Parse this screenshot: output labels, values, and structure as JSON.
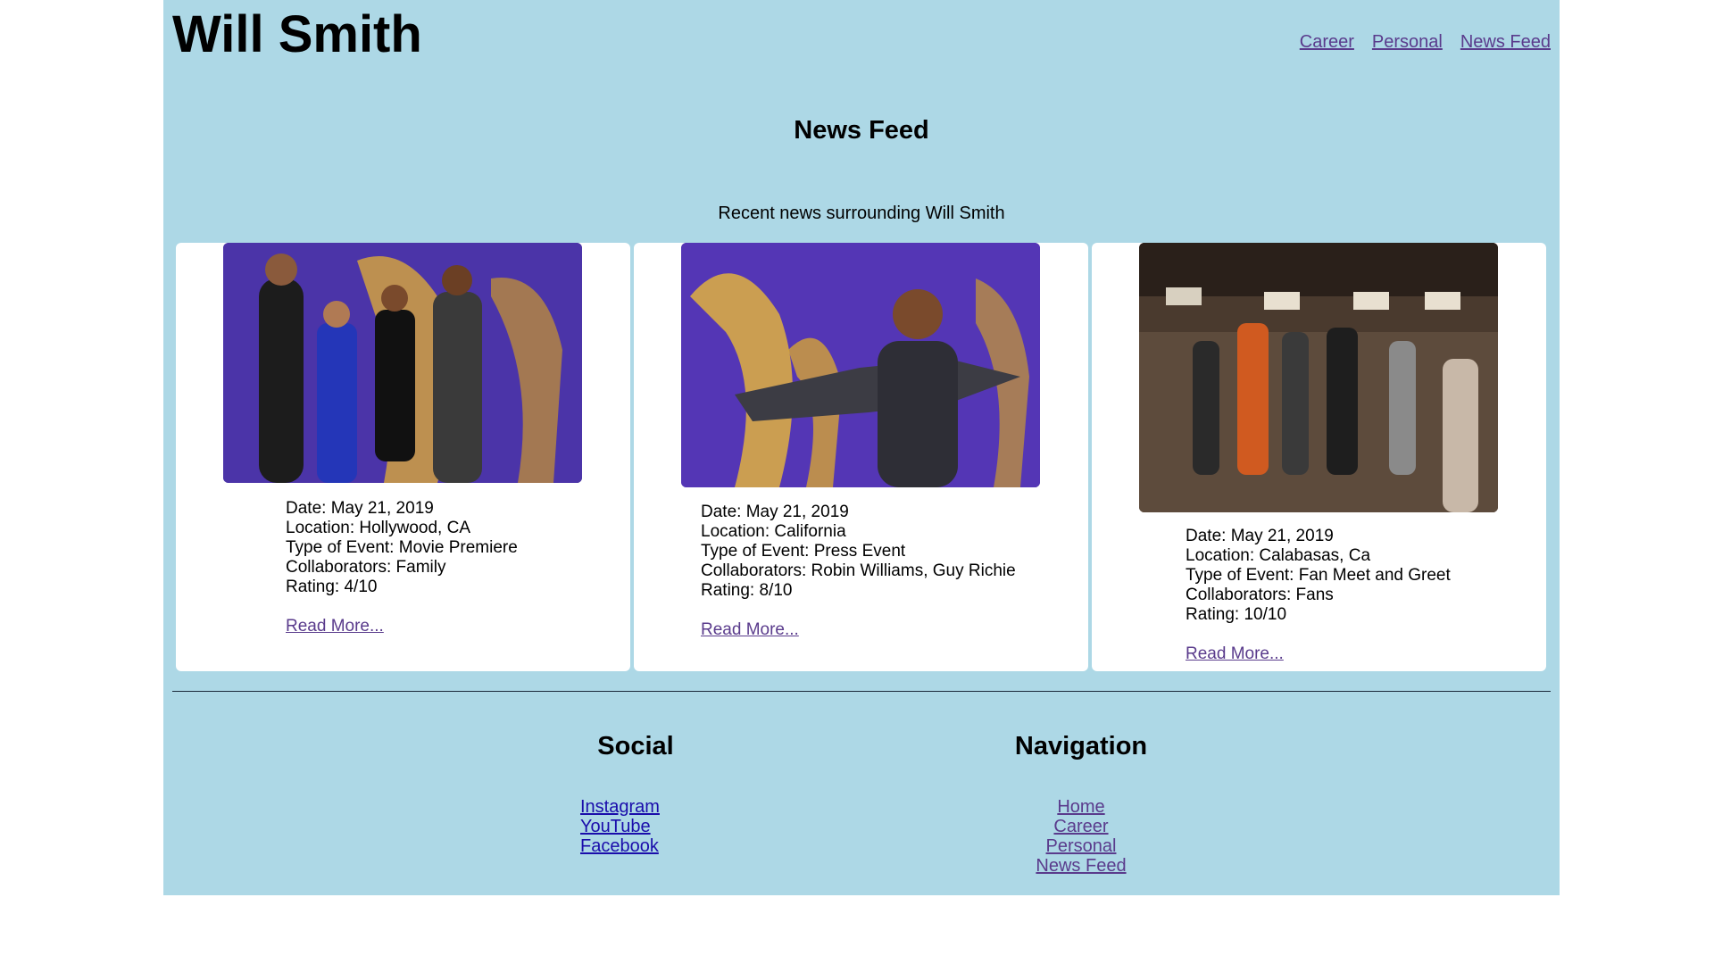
{
  "header": {
    "title": "Will Smith",
    "nav": [
      "Career",
      "Personal",
      "News Feed"
    ]
  },
  "main": {
    "heading": "News Feed",
    "subtitle": "Recent news surrounding Will Smith",
    "cards": [
      {
        "image": "Will Smith with family at Aladdin premiere",
        "date": "Date: May 21, 2019",
        "location": "Location: Hollywood, CA",
        "event": "Type of Event: Movie Premiere",
        "collaborators": "Collaborators: Family",
        "rating": "Rating: 4/10",
        "link": "Read More..."
      },
      {
        "image": "Will Smith posing at Aladdin press event",
        "date": "Date: May 21, 2019",
        "location": "Location: California",
        "event": "Type of Event: Press Event",
        "collaborators": "Collaborators: Robin Williams, Guy Richie",
        "rating": "Rating: 8/10",
        "link": "Read More..."
      },
      {
        "image": "Will Smith meeting fans in theater lobby",
        "date": "Date: May 21, 2019",
        "location": "Location: Calabasas, Ca",
        "event": "Type of Event: Fan Meet and Greet",
        "collaborators": "Collaborators: Fans",
        "rating": "Rating: 10/10",
        "link": "Read More..."
      }
    ]
  },
  "footer": {
    "social": {
      "heading": "Social",
      "links": [
        "Instagram",
        "YouTube",
        "Facebook"
      ]
    },
    "navigation": {
      "heading": "Navigation",
      "links": [
        "Home",
        "Career",
        "Personal",
        "News Feed"
      ]
    }
  },
  "colors": {
    "background": "#add8e6",
    "card": "#ffffff",
    "visited_link": "#5a3b8c",
    "link": "#1a0dab"
  }
}
